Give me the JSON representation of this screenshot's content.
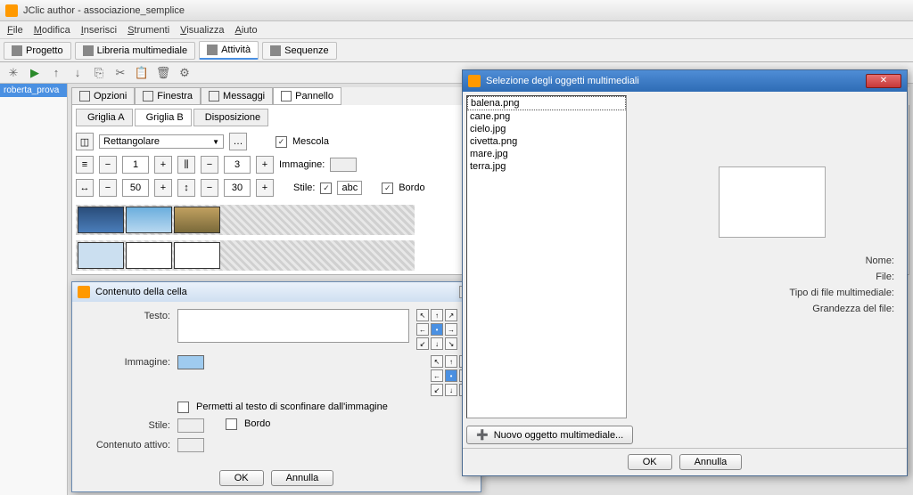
{
  "window_title": "JClic author - associazione_semplice",
  "menus": [
    "File",
    "Modifica",
    "Inserisci",
    "Strumenti",
    "Visualizza",
    "Aiuto"
  ],
  "mode_tabs": [
    {
      "label": "Progetto",
      "active": false
    },
    {
      "label": "Libreria multimediale",
      "active": false
    },
    {
      "label": "Attività",
      "active": true
    },
    {
      "label": "Sequenze",
      "active": false
    }
  ],
  "sidebar_item": "roberta_prova",
  "inner_tabs": [
    {
      "label": "Opzioni"
    },
    {
      "label": "Finestra"
    },
    {
      "label": "Messaggi"
    },
    {
      "label": "Pannello"
    }
  ],
  "subtabs": [
    {
      "label": "Griglia A"
    },
    {
      "label": "Griglia B"
    },
    {
      "label": "Disposizione"
    }
  ],
  "shape": {
    "label": "Rettangolare"
  },
  "mescola": "Mescola",
  "rows": "1",
  "cols": "3",
  "immagine_lbl": "Immagine:",
  "w": "50",
  "h": "30",
  "stile_lbl": "Stile:",
  "abc": "abc",
  "bordo": "Bordo",
  "cell_dialog": {
    "title": "Contenuto della cella",
    "testo": "Testo:",
    "immagine": "Immagine:",
    "permetti": "Permetti al testo di sconfinare dall'immagine",
    "stile": "Stile:",
    "bordo": "Bordo",
    "contenuto": "Contenuto attivo:",
    "ok": "OK",
    "annulla": "Annulla"
  },
  "media_dialog": {
    "title": "Selezione degli oggetti multimediali",
    "files": [
      "balena.png",
      "cane.png",
      "cielo.jpg",
      "civetta.png",
      "mare.jpg",
      "terra.jpg"
    ],
    "nome": "Nome:",
    "file": "File:",
    "tipo": "Tipo di file multimediale:",
    "grandezza": "Grandezza del file:",
    "nuovo": "Nuovo oggetto multimediale...",
    "ok": "OK",
    "annulla": "Annulla"
  }
}
